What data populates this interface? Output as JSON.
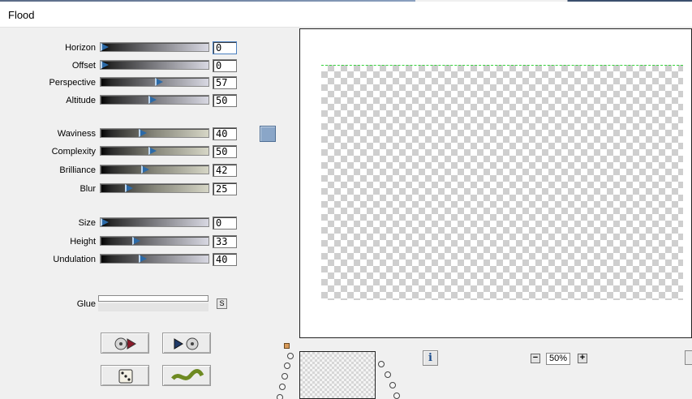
{
  "window": {
    "title": "Flood"
  },
  "sliders": [
    {
      "label": "Horizon",
      "value": "0",
      "level": 0,
      "style": "grey",
      "active": true
    },
    {
      "label": "Offset",
      "value": "0",
      "level": 0,
      "style": "grey",
      "active": false
    },
    {
      "label": "Perspective",
      "value": "57",
      "level": 57,
      "style": "grey",
      "active": false
    },
    {
      "label": "Altitude",
      "value": "50",
      "level": 50,
      "style": "grey",
      "active": false
    },
    {
      "label": "Waviness",
      "value": "40",
      "level": 40,
      "style": "tan",
      "active": false
    },
    {
      "label": "Complexity",
      "value": "50",
      "level": 50,
      "style": "tan",
      "active": false
    },
    {
      "label": "Brilliance",
      "value": "42",
      "level": 42,
      "style": "tan",
      "active": false
    },
    {
      "label": "Blur",
      "value": "25",
      "level": 25,
      "style": "tan",
      "active": false
    },
    {
      "label": "Size",
      "value": "0",
      "level": 0,
      "style": "grey",
      "active": false
    },
    {
      "label": "Height",
      "value": "33",
      "level": 33,
      "style": "grey",
      "active": false
    },
    {
      "label": "Undulation",
      "value": "40",
      "level": 40,
      "style": "grey",
      "active": false
    }
  ],
  "color_swatch": {
    "color": "#8aa6c8"
  },
  "glue": {
    "label": "Glue",
    "button_label": "S"
  },
  "tools": [
    {
      "name": "load-preset-button",
      "icon": "disc-arrow-icon"
    },
    {
      "name": "save-preset-button",
      "icon": "play-disc-icon"
    },
    {
      "name": "randomize-button",
      "icon": "dice-icon"
    },
    {
      "name": "wave-button",
      "icon": "wave-icon"
    }
  ],
  "navigator": {
    "info_label": "i"
  },
  "zoom": {
    "minus_label": "−",
    "value": "50%",
    "plus_label": "+"
  },
  "colors": {
    "accent": "#2b6aa8",
    "selection": "#35d23a",
    "swatch": "#8aa6c8"
  }
}
